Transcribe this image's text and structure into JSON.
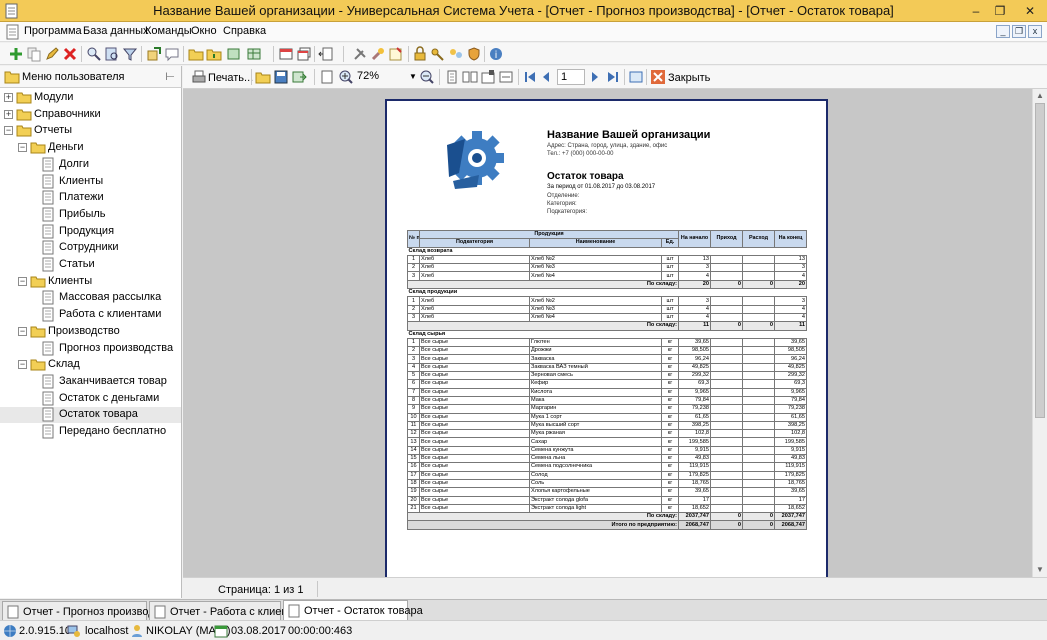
{
  "window": {
    "title": "Название Вашей организации - Универсальная Система Учета - [Отчет - Прогноз производства] - [Отчет - Остаток товара]",
    "minimize": "–",
    "maximize": "❐",
    "close": "✕"
  },
  "menu": {
    "items": [
      "Программа",
      "База данных",
      "Команды",
      "Окно",
      "Справка"
    ],
    "mdi_minimize": "_",
    "mdi_restore": "❐",
    "mdi_close": "x"
  },
  "left_panel": {
    "title": "Меню пользователя",
    "pin": "⊢",
    "tree": [
      {
        "label": "Модули",
        "expander": "+"
      },
      {
        "label": "Справочники",
        "expander": "+"
      },
      {
        "label": "Отчеты",
        "expander": "−"
      },
      {
        "label": "Деньги",
        "expander": "−"
      },
      {
        "label": "Долги"
      },
      {
        "label": "Клиенты"
      },
      {
        "label": "Платежи"
      },
      {
        "label": "Прибыль"
      },
      {
        "label": "Продукция"
      },
      {
        "label": "Сотрудники"
      },
      {
        "label": "Статьи"
      },
      {
        "label": "Клиенты",
        "expander": "−"
      },
      {
        "label": "Массовая рассылка"
      },
      {
        "label": "Работа с клиентами"
      },
      {
        "label": "Производство",
        "expander": "−"
      },
      {
        "label": "Прогноз производства"
      },
      {
        "label": "Склад",
        "expander": "−"
      },
      {
        "label": "Заканчивается товар"
      },
      {
        "label": "Остаток с деньгами"
      },
      {
        "label": "Остаток товара"
      },
      {
        "label": "Передано бесплатно"
      }
    ]
  },
  "report_toolbar": {
    "print_label": "Печать...",
    "zoom": "72%",
    "page_number": "1",
    "close_label": "Закрыть"
  },
  "report": {
    "org_name": "Название Вашей организации",
    "org_address": "Адрес: Страна, город, улица, здание, офис",
    "org_phone": "Тел.: +7 (000) 000-00-00",
    "title": "Остаток товара",
    "period": "За период от 01.08.2017 до 03.08.2017",
    "department": "Отделение:",
    "category": "Категория:",
    "subcategory": "Подкатегория:",
    "headers": {
      "no": "№ пп",
      "product": "Продукция",
      "subcategory": "Подкатегория",
      "name": "Наименование",
      "unit": "Ед.",
      "start": "На начало",
      "income": "Приход",
      "expense": "Расход",
      "end": "На конец"
    },
    "sections": [
      {
        "name": "Склад возврата",
        "rows": [
          [
            "1",
            "Хлеб",
            "Хлеб №2",
            "шт",
            "13",
            "",
            "",
            "13"
          ],
          [
            "2",
            "Хлеб",
            "Хлеб №3",
            "шт",
            "3",
            "",
            "",
            "3"
          ],
          [
            "3",
            "Хлеб",
            "Хлеб №4",
            "шт",
            "4",
            "",
            "",
            "4"
          ]
        ],
        "total_label": "По складу:",
        "total": [
          "20",
          "0",
          "0",
          "20"
        ]
      },
      {
        "name": "Склад продукции",
        "rows": [
          [
            "1",
            "Хлеб",
            "Хлеб №2",
            "шт",
            "3",
            "",
            "",
            "3"
          ],
          [
            "2",
            "Хлеб",
            "Хлеб №3",
            "шт",
            "4",
            "",
            "",
            "4"
          ],
          [
            "3",
            "Хлеб",
            "Хлеб №4",
            "шт",
            "4",
            "",
            "",
            "4"
          ]
        ],
        "total_label": "По складу:",
        "total": [
          "11",
          "0",
          "0",
          "11"
        ]
      },
      {
        "name": "Склад сырья",
        "rows": [
          [
            "1",
            "Все сырье",
            "Глютен",
            "кг",
            "39,65",
            "",
            "",
            "39,65"
          ],
          [
            "2",
            "Все сырье",
            "Дрожжи",
            "кг",
            "98,505",
            "",
            "",
            "98,505"
          ],
          [
            "3",
            "Все сырье",
            "Закваска",
            "кг",
            "96,24",
            "",
            "",
            "96,24"
          ],
          [
            "4",
            "Все сырье",
            "Закваска ВАЗ темный",
            "кг",
            "49,825",
            "",
            "",
            "49,825"
          ],
          [
            "5",
            "Все сырье",
            "Зерновая смесь",
            "кг",
            "299,32",
            "",
            "",
            "299,32"
          ],
          [
            "6",
            "Все сырье",
            "Кефир",
            "кг",
            "69,3",
            "",
            "",
            "69,3"
          ],
          [
            "7",
            "Все сырье",
            "Кислота",
            "кг",
            "9,965",
            "",
            "",
            "9,965"
          ],
          [
            "8",
            "Все сырье",
            "Мака",
            "кг",
            "79,84",
            "",
            "",
            "79,84"
          ],
          [
            "9",
            "Все сырье",
            "Маргарин",
            "кг",
            "79,238",
            "",
            "",
            "79,238"
          ],
          [
            "10",
            "Все сырье",
            "Мука 1 сорт",
            "кг",
            "61,65",
            "",
            "",
            "61,65"
          ],
          [
            "11",
            "Все сырье",
            "Мука высший сорт",
            "кг",
            "398,25",
            "",
            "",
            "398,25"
          ],
          [
            "12",
            "Все сырье",
            "Мука ржаная",
            "кг",
            "102,8",
            "",
            "",
            "102,8"
          ],
          [
            "13",
            "Все сырье",
            "Сахар",
            "кг",
            "199,585",
            "",
            "",
            "199,585"
          ],
          [
            "14",
            "Все сырье",
            "Семена кунжута",
            "кг",
            "9,915",
            "",
            "",
            "9,915"
          ],
          [
            "15",
            "Все сырье",
            "Семена льна",
            "кг",
            "49,83",
            "",
            "",
            "49,83"
          ],
          [
            "16",
            "Все сырье",
            "Семена подсолнечника",
            "кг",
            "119,915",
            "",
            "",
            "119,915"
          ],
          [
            "17",
            "Все сырье",
            "Солод",
            "кг",
            "179,825",
            "",
            "",
            "179,825"
          ],
          [
            "18",
            "Все сырье",
            "Соль",
            "кг",
            "18,765",
            "",
            "",
            "18,765"
          ],
          [
            "19",
            "Все сырье",
            "Хлопья картофельные",
            "кг",
            "39,65",
            "",
            "",
            "39,65"
          ],
          [
            "20",
            "Все сырье",
            "Экстракт солода glofa",
            "кг",
            "17",
            "",
            "",
            "17"
          ],
          [
            "21",
            "Все сырье",
            "Экстракт солода light",
            "кг",
            "18,652",
            "",
            "",
            "18,652"
          ]
        ],
        "total_label": "По складу:",
        "total": [
          "2037,747",
          "0",
          "0",
          "2037,747"
        ]
      }
    ],
    "grand_total_label": "Итого по предприятию:",
    "grand_total": [
      "2068,747",
      "0",
      "0",
      "2068,747"
    ]
  },
  "page_status": "Страница: 1 из 1",
  "tabs": [
    {
      "label": "Отчет - Прогноз производства"
    },
    {
      "label": "Отчет - Работа с клиентами"
    },
    {
      "label": "Отчет - Остаток товара",
      "active": true
    }
  ],
  "statusbar": {
    "version": "2.0.915.10",
    "host": "localhost",
    "user": "NIKOLAY (MAIN)",
    "date": "03.08.2017",
    "timer": "00:00:00:463"
  }
}
